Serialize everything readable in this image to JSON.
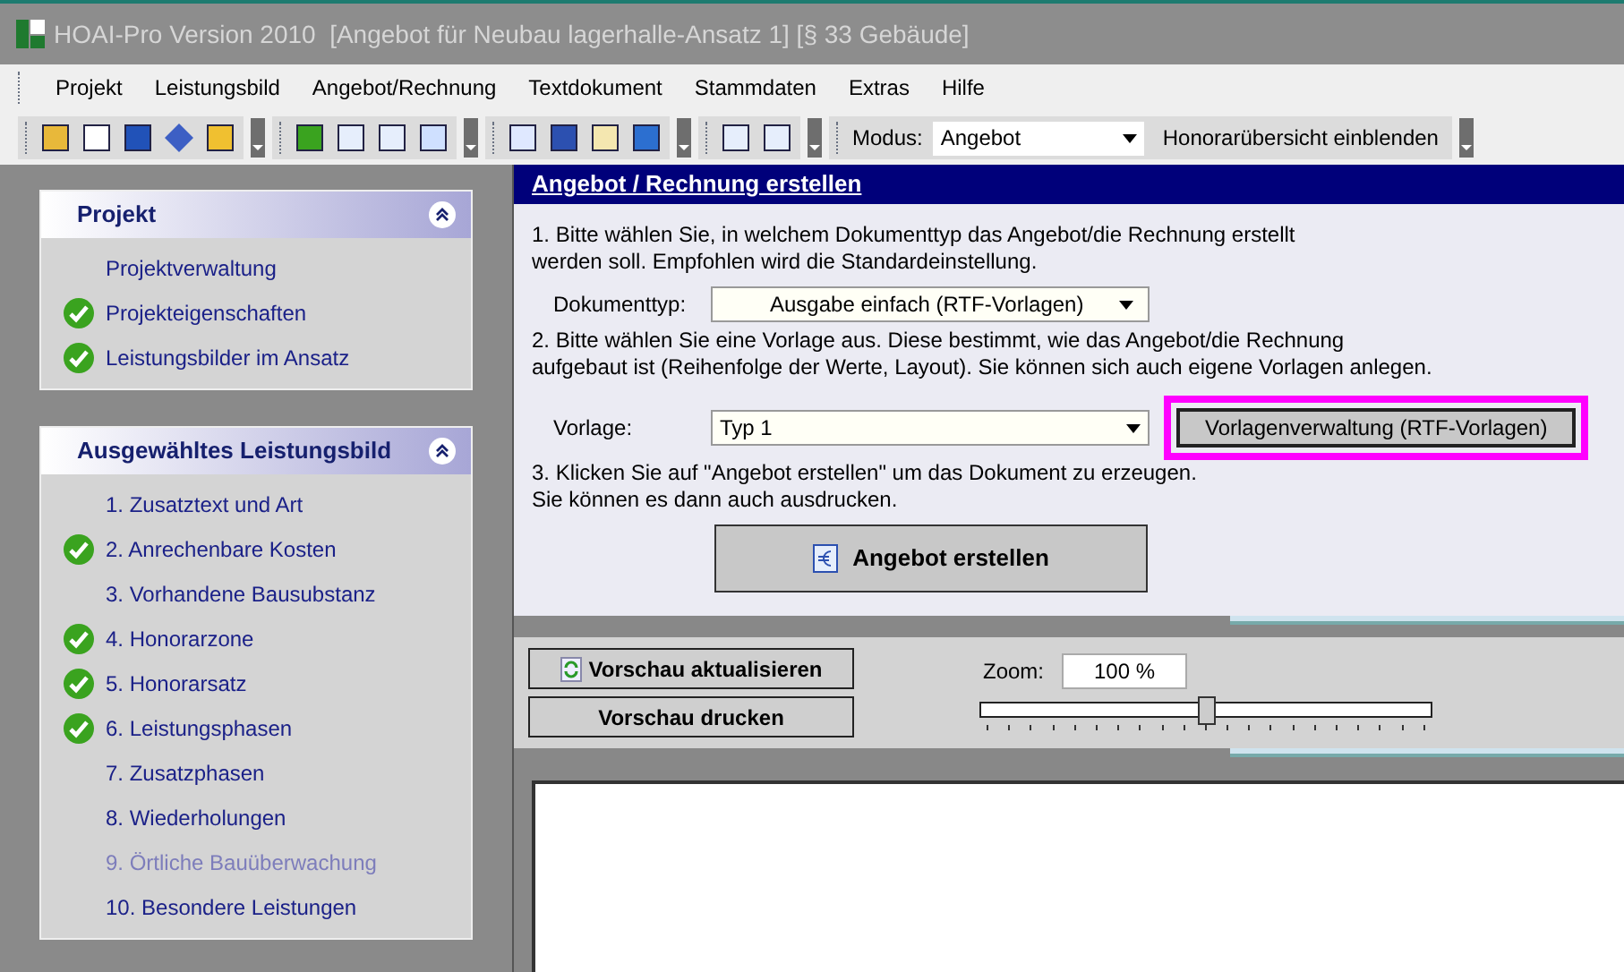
{
  "window": {
    "title": "HOAI-Pro Version 2010  [Angebot für Neubau lagerhalle-Ansatz 1] [§ 33 Gebäude]"
  },
  "menu": [
    "Projekt",
    "Leistungsbild",
    "Angebot/Rechnung",
    "Textdokument",
    "Stammdaten",
    "Extras",
    "Hilfe"
  ],
  "toolbar": {
    "modus_label": "Modus:",
    "modus_value": "Angebot",
    "toggle_button": "Honorarübersicht einblenden"
  },
  "sidebar": [
    {
      "title": "Projekt",
      "expanded": true,
      "items": [
        {
          "label": "Projektverwaltung",
          "checked": false,
          "disabled": false
        },
        {
          "label": "Projekteigenschaften",
          "checked": true,
          "disabled": false
        },
        {
          "label": "Leistungsbilder im Ansatz",
          "checked": true,
          "disabled": false
        }
      ]
    },
    {
      "title": "Ausgewähltes Leistungsbild",
      "expanded": true,
      "items": [
        {
          "label": "1. Zusatztext und Art",
          "checked": false,
          "disabled": false
        },
        {
          "label": "2. Anrechenbare Kosten",
          "checked": true,
          "disabled": false
        },
        {
          "label": "3. Vorhandene Bausubstanz",
          "checked": false,
          "disabled": false
        },
        {
          "label": "4. Honorarzone",
          "checked": true,
          "disabled": false
        },
        {
          "label": "5. Honorarsatz",
          "checked": true,
          "disabled": false
        },
        {
          "label": "6. Leistungsphasen",
          "checked": true,
          "disabled": false
        },
        {
          "label": "7. Zusatzphasen",
          "checked": false,
          "disabled": false
        },
        {
          "label": "8. Wiederholungen",
          "checked": false,
          "disabled": false
        },
        {
          "label": "9. Örtliche Bauüberwachung",
          "checked": false,
          "disabled": true
        },
        {
          "label": "10. Besondere Leistungen",
          "checked": false,
          "disabled": false
        }
      ]
    }
  ],
  "main": {
    "title": "Angebot / Rechnung erstellen",
    "step1": "1. Bitte wählen Sie, in welchem Dokumenttyp das Angebot/die Rechnung erstellt\nwerden soll. Empfohlen wird die Standardeinstellung.",
    "doc_label": "Dokumenttyp:",
    "doc_value": "Ausgabe einfach (RTF-Vorlagen)",
    "step2": "2. Bitte wählen Sie eine Vorlage aus. Diese bestimmt, wie das Angebot/die Rechnung\naufgebaut ist (Reihenfolge der Werte, Layout). Sie können sich auch eigene Vorlagen anlegen.",
    "template_label": "Vorlage:",
    "template_value": "Typ 1",
    "manage_button": "Vorlagenverwaltung (RTF-Vorlagen)",
    "step3": "3. Klicken Sie auf \"Angebot erstellen\" um das Dokument zu erzeugen.\nSie können es dann auch ausdrucken.",
    "create_button": "Angebot erstellen"
  },
  "preview": {
    "refresh_button": "Vorschau aktualisieren",
    "print_button": "Vorschau drucken",
    "zoom_label": "Zoom:",
    "zoom_value": "100 %",
    "level": 0.5
  }
}
